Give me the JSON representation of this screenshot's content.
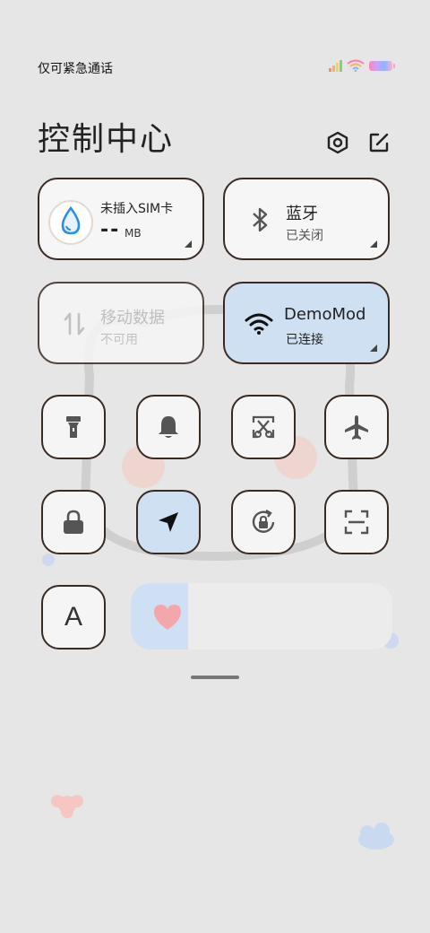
{
  "status_bar": {
    "carrier_text": "仅可紧急通话"
  },
  "header": {
    "title": "控制中心"
  },
  "cards": {
    "sim": {
      "label": "未插入SIM卡",
      "value": "--",
      "unit": "MB"
    },
    "bluetooth": {
      "label": "蓝牙",
      "status": "已关闭"
    },
    "mobile_data": {
      "label": "移动数据",
      "status": "不可用"
    },
    "wifi": {
      "label": "DemoMod",
      "status": "已连接"
    }
  },
  "tiles_row1": [
    {
      "icon": "flashlight-icon"
    },
    {
      "icon": "bell-icon"
    },
    {
      "icon": "screenshot-icon"
    },
    {
      "icon": "airplane-icon"
    }
  ],
  "tiles_row2": [
    {
      "icon": "lock-icon"
    },
    {
      "icon": "location-icon",
      "active": true
    },
    {
      "icon": "rotation-lock-icon"
    },
    {
      "icon": "scan-icon"
    }
  ],
  "font_tile": {
    "label": "A"
  },
  "brightness": {
    "level": 0.22
  },
  "colors": {
    "accent_blue": "#cfe0f3",
    "border": "#3a2a24",
    "background": "#e6e6e6"
  }
}
